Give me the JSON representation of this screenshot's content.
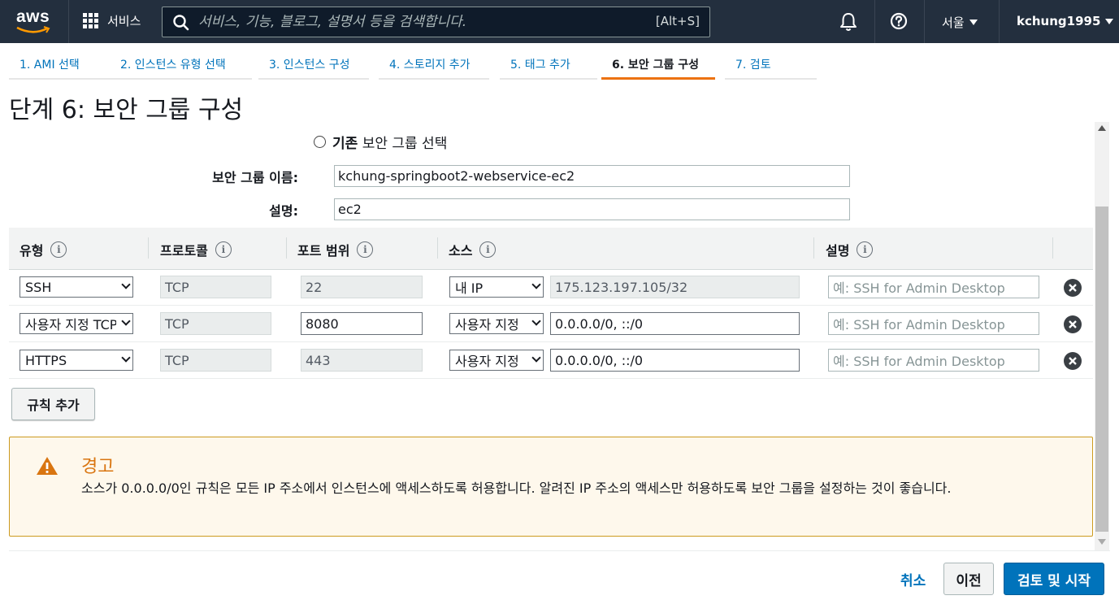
{
  "nav": {
    "logo_text": "aws",
    "services_label": "서비스",
    "search_placeholder": "서비스, 기능, 블로그, 설명서 등을 검색합니다.",
    "search_shortcut": "[Alt+S]",
    "region": "서울",
    "user": "kchung1995"
  },
  "tabs": [
    {
      "label": "1. AMI 선택"
    },
    {
      "label": "2. 인스턴스 유형 선택"
    },
    {
      "label": "3. 인스턴스 구성"
    },
    {
      "label": "4. 스토리지 추가"
    },
    {
      "label": "5. 태그 추가"
    },
    {
      "label": "6. 보안 그룹 구성",
      "active": true
    },
    {
      "label": "7. 검토"
    }
  ],
  "page_title": "단계 6: 보안 그룹 구성",
  "form": {
    "existing_radio_bold": "기존",
    "existing_radio_rest": "보안 그룹 선택",
    "sg_name_label": "보안 그룹 이름:",
    "sg_name_value": "kchung-springboot2-webservice-ec2",
    "description_label": "설명:",
    "description_value": "ec2"
  },
  "rules": {
    "headers": [
      "유형",
      "프로토콜",
      "포트 범위",
      "소스",
      "설명"
    ],
    "rows": [
      {
        "type": "SSH",
        "protocol": "TCP",
        "port": "22",
        "port_editable": false,
        "source_type": "내 IP",
        "source": "175.123.197.105/32",
        "source_editable": false,
        "desc_placeholder": "예: SSH for Admin Desktop"
      },
      {
        "type": "사용자 지정 TCP",
        "protocol": "TCP",
        "port": "8080",
        "port_editable": true,
        "source_type": "사용자 지정",
        "source": "0.0.0.0/0, ::/0",
        "source_editable": true,
        "desc_placeholder": "예: SSH for Admin Desktop"
      },
      {
        "type": "HTTPS",
        "protocol": "TCP",
        "port": "443",
        "port_editable": false,
        "source_type": "사용자 지정",
        "source": "0.0.0.0/0, ::/0",
        "source_editable": true,
        "desc_placeholder": "예: SSH for Admin Desktop"
      }
    ],
    "add_rule_label": "규칙 추가"
  },
  "alert": {
    "title": "경고",
    "body": "소스가 0.0.0.0/0인 규칙은 모든 IP 주소에서 인스턴스에 액세스하도록 허용합니다. 알려진 IP 주소의 액세스만 허용하도록 보안 그룹을 설정하는 것이 좋습니다.",
    "color": "#d97510"
  },
  "footer": {
    "cancel_label": "취소",
    "prev_label": "이전",
    "launch_label": "검토 및 시작"
  },
  "colors": {
    "nav_bg": "#232f3e",
    "accent": "#ec7211",
    "link": "#0073bb",
    "primary_button": "#0073bb"
  }
}
